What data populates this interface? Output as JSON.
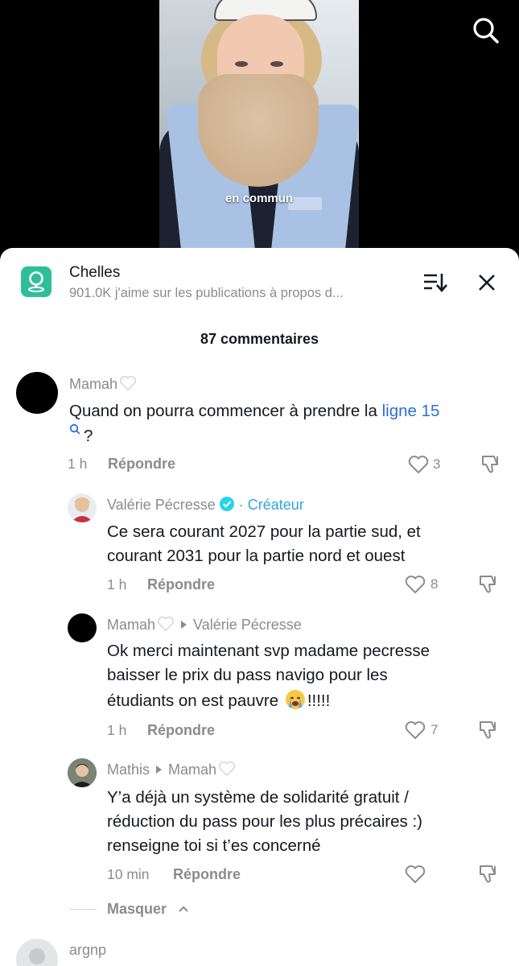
{
  "video": {
    "caption": "en commun"
  },
  "header": {
    "title": "Chelles",
    "subtitle": "901.0K j'aime sur les publications à propos d..."
  },
  "comments_count": "87 commentaires",
  "comments": [
    {
      "username": "Mamah",
      "text_main": "Quand on pourra commencer à prendre la ",
      "text_link": "ligne 15",
      "text_end": "?",
      "time": "1 h",
      "reply_label": "Répondre",
      "likes": "3"
    },
    {
      "username": "Valérie Pécresse",
      "creator_label": "· Créateur",
      "text_line1": "Ce sera courant 2027 pour la partie sud, et",
      "text_line2": "courant 2031 pour la partie nord et ouest",
      "time": "1 h",
      "reply_label": "Répondre",
      "likes": "8"
    },
    {
      "username": "Mamah",
      "reply_to": "Valérie Pécresse",
      "text_line1": "Ok merci maintenant svp madame pecresse",
      "text_line2": "baisser le prix du pass navigo pour les",
      "text_line3a": "étudiants on est pauvre ",
      "text_line3b": "!!!!!",
      "time": "1 h",
      "reply_label": "Répondre",
      "likes": "7"
    },
    {
      "username": "Mathis",
      "reply_to": "Mamah",
      "text_line1": "Y’a déjà un système de solidarité gratuit /",
      "text_line2": "réduction du pass pour les plus précaires :)",
      "text_line3": "renseigne toi si t’es concerné",
      "time": "10 min",
      "reply_label": "Répondre"
    },
    {
      "username": "argnp"
    }
  ],
  "hide_label": "Masquer",
  "colors": {
    "accent_link": "#2b6fd4",
    "creator": "#2aa9dd",
    "place_icon": "#2ebf9a",
    "muted_text": "#8a8b91"
  },
  "icons": [
    "search-icon",
    "location-pin-icon",
    "sort-icon",
    "close-icon",
    "heart-outline-icon",
    "thumbs-down-icon",
    "white-heart-emoji",
    "verified-badge-icon",
    "crying-face-emoji",
    "search-suggestion-icon",
    "chevron-up-icon"
  ]
}
